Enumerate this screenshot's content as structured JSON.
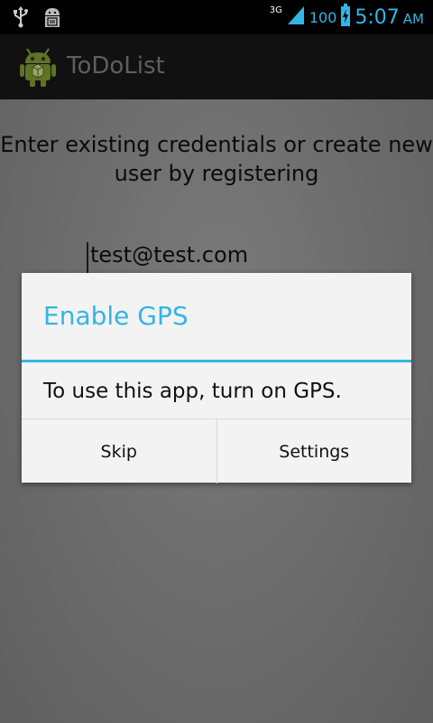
{
  "status_bar": {
    "network_type": "3G",
    "battery_level": "100",
    "time": "5:07",
    "am_pm": "AM",
    "icons": [
      "usb-icon",
      "android-debug-icon",
      "signal-icon",
      "battery-charging-icon"
    ],
    "accent_color": "#33b5e5"
  },
  "action_bar": {
    "title": "ToDoList",
    "icon": "android-robot-icon"
  },
  "main": {
    "intro_text": "Enter existing credentials or create new user by registering",
    "email_value": "test@test.com"
  },
  "dialog": {
    "title": "Enable GPS",
    "message": "To use this app, turn on GPS.",
    "buttons": [
      "Skip",
      "Settings"
    ],
    "accent_color": "#33b5e5"
  }
}
